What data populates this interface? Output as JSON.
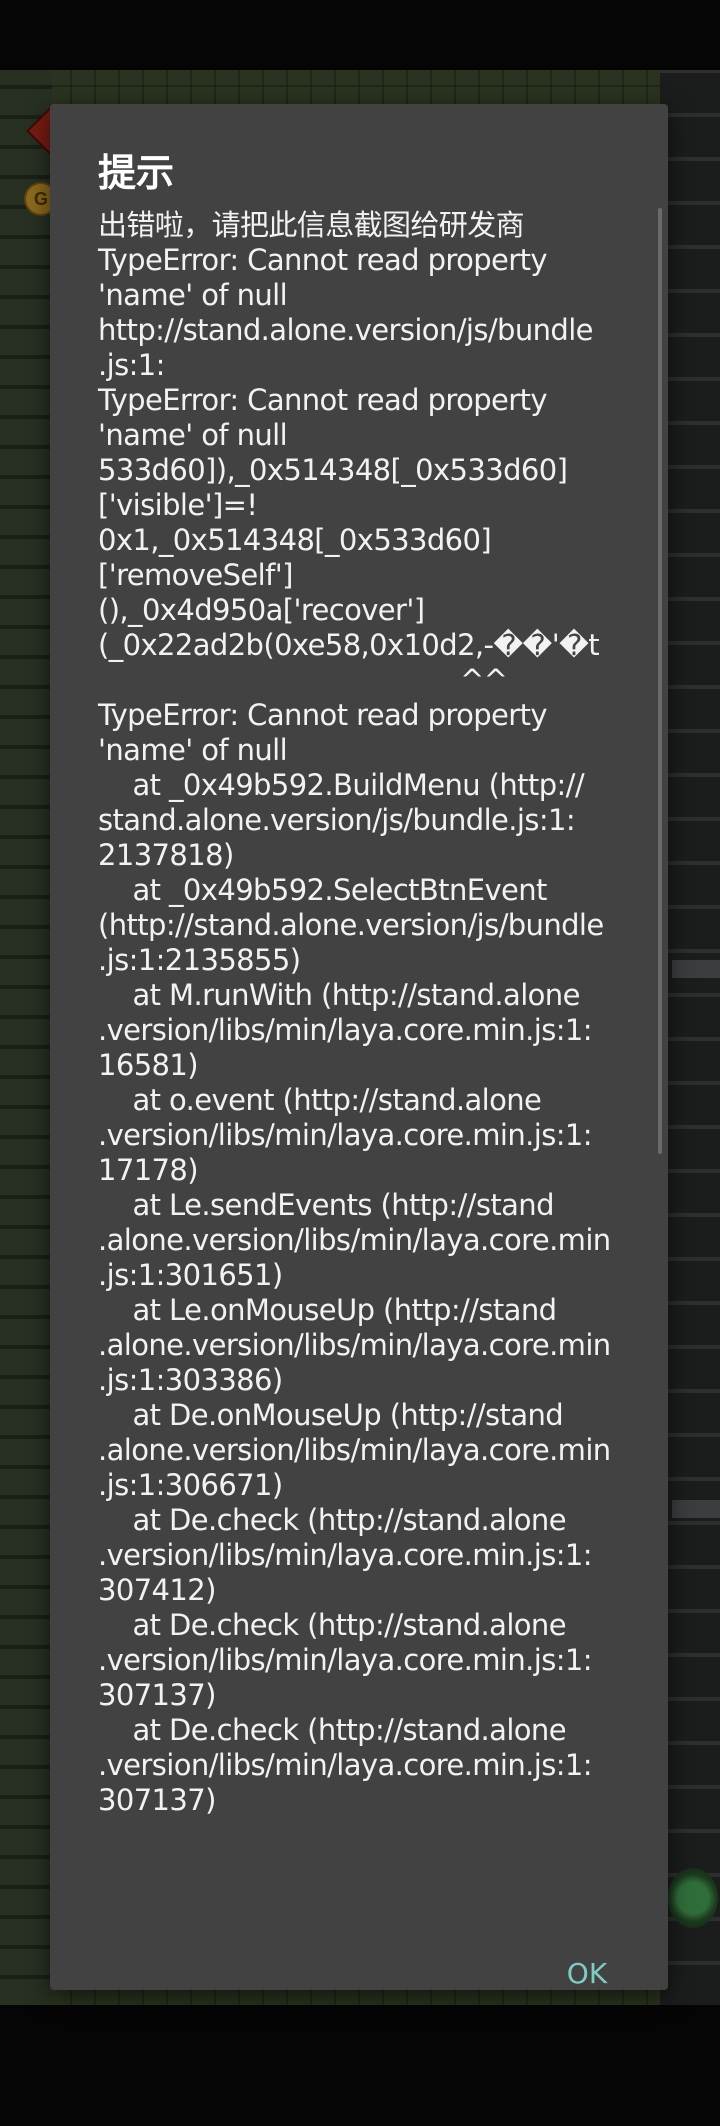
{
  "background": {
    "coin_glyph": "G",
    "colors": {
      "game_floor": "#2b3320",
      "overlay_dialog": "#424242",
      "accent": "#80cbc4"
    }
  },
  "dialog": {
    "title": "提示",
    "message_lines": [
      "出错啦，请把此信息截图给研发商",
      "TypeError: Cannot read property",
      "'name' of null",
      "http://stand.alone.version/js/bundle",
      ".js:1:",
      "TypeError: Cannot read property",
      "'name' of null",
      "533d60]),_0x514348[_0x533d60]",
      "['visible']=!",
      "0x1,_0x514348[_0x533d60]",
      "['removeSelf']",
      "(),_0x4d950a['recover']",
      "(_0x22ad2b(0xe58,0x10d2,-��'�t",
      "                                          ^^",
      "TypeError: Cannot read property",
      "'name' of null",
      "    at _0x49b592.BuildMenu (http://",
      "stand.alone.version/js/bundle.js:1:",
      "2137818)",
      "    at _0x49b592.SelectBtnEvent",
      "(http://stand.alone.version/js/bundle",
      ".js:1:2135855)",
      "    at M.runWith (http://stand.alone",
      ".version/libs/min/laya.core.min.js:1:",
      "16581)",
      "    at o.event (http://stand.alone",
      ".version/libs/min/laya.core.min.js:1:",
      "17178)",
      "    at Le.sendEvents (http://stand",
      ".alone.version/libs/min/laya.core.min",
      ".js:1:301651)",
      "    at Le.onMouseUp (http://stand",
      ".alone.version/libs/min/laya.core.min",
      ".js:1:303386)",
      "    at De.onMouseUp (http://stand",
      ".alone.version/libs/min/laya.core.min",
      ".js:1:306671)",
      "    at De.check (http://stand.alone",
      ".version/libs/min/laya.core.min.js:1:",
      "307412)",
      "    at De.check (http://stand.alone",
      ".version/libs/min/laya.core.min.js:1:",
      "307137)",
      "    at De.check (http://stand.alone",
      ".version/libs/min/laya.core.min.js:1:",
      "307137)"
    ],
    "ok_label": "OK"
  }
}
